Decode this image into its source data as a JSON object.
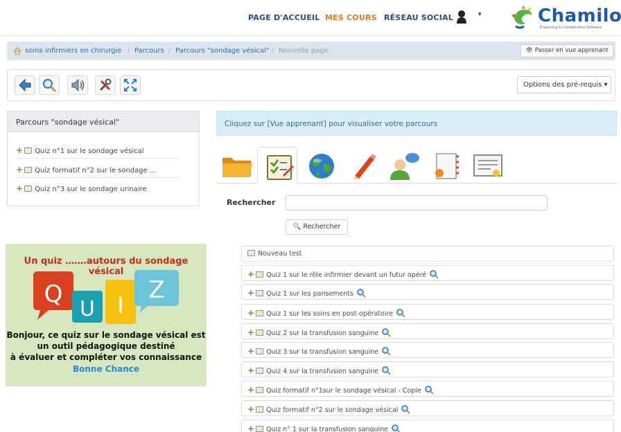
{
  "nav": {
    "home": "PAGE D'ACCUEIL",
    "courses": "MES COURS",
    "social": "RÉSEAU SOCIAL",
    "user_caret": "▾"
  },
  "logo": {
    "name": "Chamilo",
    "tagline": "E-learning & Collaboration Software"
  },
  "breadcrumb": {
    "items": [
      "soins infirmiers en chirurgie",
      "Parcours",
      "Parcours \"sondage vésical\"",
      "Nouvelle page"
    ],
    "sep": "/",
    "preview_button": "Passer en vue apprenant"
  },
  "toolbar": {
    "icons": [
      "back-arrow-icon",
      "magnifier-icon",
      "audio-icon",
      "tools-icon",
      "fullscreen-icon"
    ],
    "options_label": "Options des pré-requis ▾"
  },
  "left_panel": {
    "title": "Parcours \"sondage vésical\"",
    "items": [
      "Quiz n°1 sur le sondage vésical",
      "Quiz formatif n°2 sur le sondage ...",
      "Quiz n°3 sur le sondage urinaire"
    ]
  },
  "quiz_image": {
    "title": "Un quiz …….autours du sondage vésical",
    "letters": [
      "Q",
      "U",
      "I",
      "Z"
    ],
    "line1": "Bonjour, ce quiz sur le sondage vésical est",
    "line2": "un outil pédagogique destiné",
    "line3": "à évaluer et compléter vos  connaissance",
    "closing": "Bonne Chance"
  },
  "alert": "Cliquez sur [Vue apprenant] pour visualiser votre parcours",
  "tabs": [
    "folder-icon",
    "quiz-checklist-icon",
    "globe-icon",
    "pencil-icon",
    "user-chat-icon",
    "notebook-icon",
    "certificate-icon"
  ],
  "search": {
    "label": "Rechercher",
    "button": "Rechercher",
    "value": ""
  },
  "list": {
    "new_test": "Nouveau test",
    "items": [
      "Quiz 1 sur le rôle infirmier devant un futur opéré",
      "Quiz 1 sur les pansements",
      "Quiz 1 sur les soins en post-opératoire",
      "Quiz 2 sur la transfusion sanguine",
      "Quiz 3 sur la transfusion sanguine",
      "Quiz 4 sur la transfusion sanguine",
      "Quiz formatif n°1sur le sondage vésical - Copie",
      "Quiz formatif n°2 sur le sondage vésical",
      "Quiz n° 1 sur la transfusion sanguine"
    ]
  },
  "colors": {
    "nav_text": "#2b4a7a",
    "nav_active": "#e8761b",
    "link": "#2d6aa8",
    "alert_bg": "#d9edf7",
    "add_green": "#4fa32c",
    "quiz_red": "#c12b20",
    "quiz_blue": "#2e85cc"
  }
}
